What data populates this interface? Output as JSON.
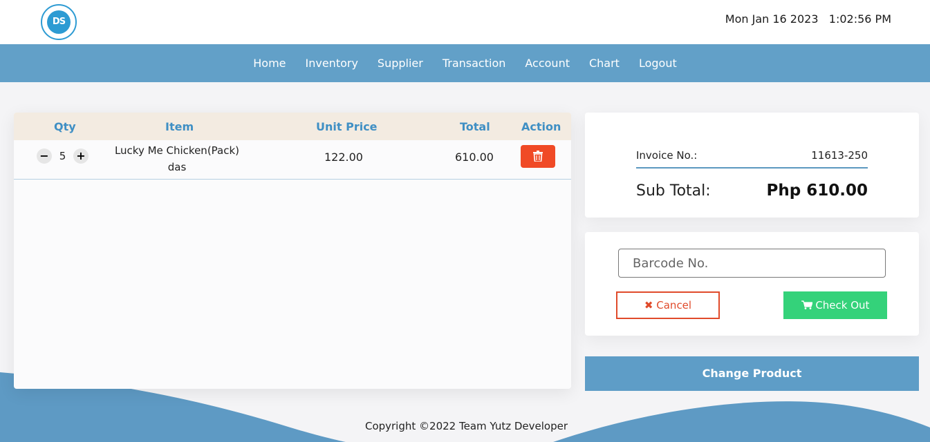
{
  "header": {
    "logo_text": "DS",
    "date": "Mon Jan 16 2023",
    "time": "1:02:56 PM"
  },
  "nav": {
    "items": [
      "Home",
      "Inventory",
      "Supplier",
      "Transaction",
      "Account",
      "Chart",
      "Logout"
    ]
  },
  "table": {
    "headers": [
      "Qty",
      "Item",
      "Unit Price",
      "Total",
      "Action"
    ],
    "rows": [
      {
        "qty": "5",
        "item_line1": "Lucky Me Chicken(Pack)",
        "item_line2": "das",
        "unit_price": "122.00",
        "total": "610.00",
        "action_icon": "trash-icon"
      }
    ]
  },
  "invoice": {
    "label": "Invoice No.:",
    "value": "11613-250",
    "subtotal_label": "Sub Total:",
    "subtotal_value": "Php 610.00"
  },
  "barcode": {
    "placeholder": "Barcode No."
  },
  "buttons": {
    "cancel": "Cancel",
    "checkout": "Check Out",
    "change_product": "Change Product"
  },
  "footer": {
    "copyright": "Copyright ©2022 Team Yutz Developer"
  },
  "colors": {
    "nav": "#62a0c8",
    "accent_blue": "#3f8fc4",
    "delete_red": "#f04a26",
    "checkout_green": "#34d27a",
    "table_header": "#f3ebe1"
  }
}
